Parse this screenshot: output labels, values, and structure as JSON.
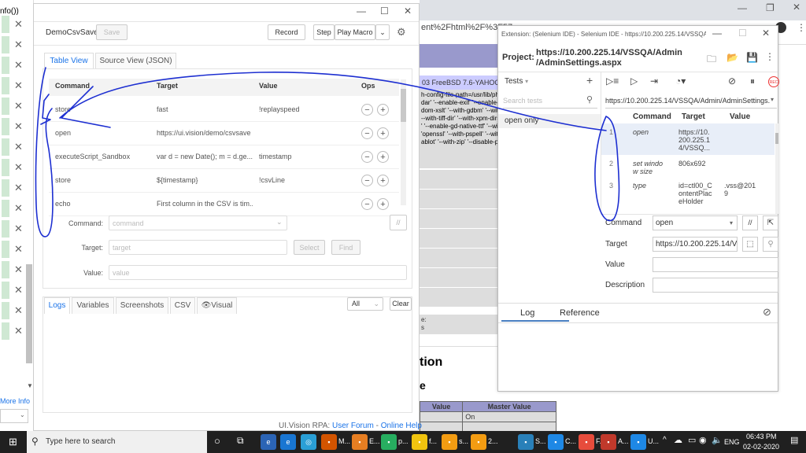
{
  "background_page": {
    "url": "ent%2Fhtml%2F%3F57",
    "banner_row_text": "03 FreeBSD 7.6-YAHOO-20",
    "config_text": "h-config-file-path=/usr/lib/ph\ndar' '--enable-exif' '--enable-\ndom-xslt' '--with-gdbm' '--wit\n--with-tiff-dir' '--with-xpm-dir=\n' '--enable-gd-native-ttf' '--wi\n'openssl' '--with-pspell' '--with\nablot' '--with-zip' '--disable-pc",
    "section_title": "tion",
    "section_title2": "e",
    "table_headers": [
      "Value",
      "Master Value"
    ],
    "table_cell": "On",
    "side_text1": "e:",
    "side_text2": "s"
  },
  "left_strip": {
    "title": "nfo())",
    "more_info": "More Info"
  },
  "uivision": {
    "macro_name": "DemoCsvSave",
    "save_label": "Save",
    "record_label": "Record",
    "step_label": "Step",
    "play_label": "Play Macro",
    "tabs": [
      "Table View",
      "Source View (JSON)"
    ],
    "columns": [
      "Command",
      "Target",
      "Value",
      "Ops"
    ],
    "rows": [
      {
        "command": "store",
        "target": "fast",
        "value": "!replayspeed"
      },
      {
        "command": "open",
        "target": "https://ui.vision/demo/csvsave",
        "value": ""
      },
      {
        "command": "executeScript_Sandbox",
        "target": "var d = new Date(); m = d.ge...",
        "value": "timestamp"
      },
      {
        "command": "store",
        "target": "${timestamp}",
        "value": "!csvLine"
      },
      {
        "command": "echo",
        "target": "First column in the CSV is tim...",
        "value": ""
      }
    ],
    "ops_minus": "−",
    "ops_plus": "+",
    "command_label": "Command:",
    "command_placeholder": "command",
    "target_label": "Target:",
    "target_placeholder": "target",
    "select_label": "Select",
    "find_label": "Find",
    "value_label": "Value:",
    "value_placeholder": "value",
    "log_tabs": [
      "Logs",
      "Variables",
      "Screenshots",
      "CSV",
      "👁Visual"
    ],
    "filter_value": "All",
    "clear_label": "Clear",
    "footer_prefix": "UI.Vision RPA:",
    "footer_link1": "User Forum",
    "footer_sep": "-",
    "footer_link2": "Online Help"
  },
  "selenium": {
    "window_title": "Extension: (Selenium IDE) - Selenium IDE - https://10.200.225.14/VSSQA",
    "project_label": "Project:",
    "project_url_line1": "https://10.200.225.14/VSSQA/Admin",
    "project_url_line2": "/AdminSettings.aspx",
    "tests_label": "Tests",
    "add_label": "+",
    "search_placeholder": "Search tests",
    "url_select": "https://10.200.225.14/VSSQA/Admin/AdminSettings.",
    "test_item": "open only",
    "columns": [
      "Command",
      "Target",
      "Value"
    ],
    "rows": [
      {
        "num": "1",
        "command": "open",
        "target_lines": [
          "https://10.",
          "200.225.1",
          "4/VSSQ..."
        ],
        "value_lines": []
      },
      {
        "num": "2",
        "command_lines": [
          "set windo",
          "w size"
        ],
        "target_lines": [
          "806x692"
        ],
        "value_lines": []
      },
      {
        "num": "3",
        "command": "type",
        "target_lines": [
          "id=ctl00_C",
          "ontentPlac",
          "eHolder"
        ],
        "value_lines": [
          ".vss@201",
          "9"
        ]
      }
    ],
    "command_label": "Command",
    "command_value": "open",
    "target_label": "Target",
    "target_value": "https://10.200.225.14/V",
    "value_label": "Value",
    "description_label": "Description",
    "bottom_tabs": [
      "Log",
      "Reference"
    ],
    "rec_label": "REC"
  },
  "taskbar": {
    "search_placeholder": "Type here to search",
    "apps": [
      "M...",
      "E...",
      "p...",
      "f...",
      "s...",
      "2...",
      "S...",
      "C...",
      "F...",
      "A...",
      "U..."
    ],
    "lang": "ENG",
    "time": "06:43 PM",
    "date": "02-02-2020"
  }
}
